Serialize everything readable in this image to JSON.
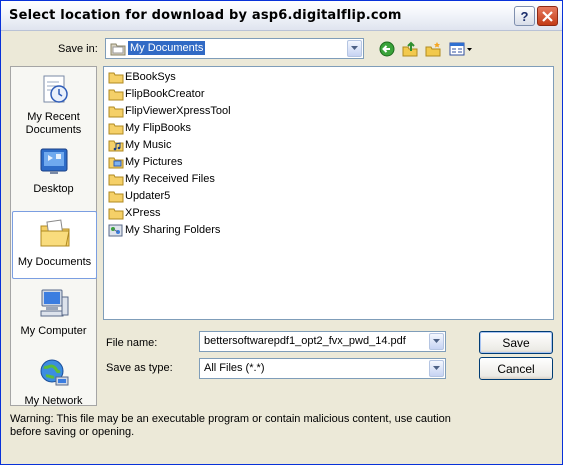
{
  "window": {
    "title": "Select location for download by asp6.digitalflip.com"
  },
  "toolbar": {
    "save_in_label": "Save in:",
    "save_in_value": "My Documents"
  },
  "places": [
    {
      "label_line1": "My Recent",
      "label_line2": "Documents",
      "icon": "recent-documents-icon"
    },
    {
      "label_line1": "Desktop",
      "label_line2": "",
      "icon": "desktop-icon"
    },
    {
      "label_line1": "My Documents",
      "label_line2": "",
      "icon": "my-documents-icon",
      "selected": true
    },
    {
      "label_line1": "My Computer",
      "label_line2": "",
      "icon": "my-computer-icon"
    },
    {
      "label_line1": "My Network",
      "label_line2": "",
      "icon": "my-network-icon"
    }
  ],
  "files": [
    {
      "name": "EBookSys",
      "icon": "folder-icon"
    },
    {
      "name": "FlipBookCreator",
      "icon": "folder-icon"
    },
    {
      "name": "FlipViewerXpressTool",
      "icon": "folder-icon"
    },
    {
      "name": "My FlipBooks",
      "icon": "folder-icon"
    },
    {
      "name": "My Music",
      "icon": "music-folder-icon"
    },
    {
      "name": "My Pictures",
      "icon": "pictures-folder-icon"
    },
    {
      "name": "My Received Files",
      "icon": "folder-icon"
    },
    {
      "name": "Updater5",
      "icon": "folder-icon"
    },
    {
      "name": "XPress",
      "icon": "folder-icon"
    },
    {
      "name": "My Sharing Folders",
      "icon": "sharing-folder-icon"
    }
  ],
  "form": {
    "file_name_label": "File name:",
    "file_name_value": "bettersoftwarepdf1_opt2_fvx_pwd_14.pdf",
    "save_as_type_label": "Save as type:",
    "save_as_type_value": "All Files (*.*)"
  },
  "buttons": {
    "save": "Save",
    "cancel": "Cancel"
  },
  "warning": "Warning: This file may be an executable program or contain malicious content, use caution before saving or opening."
}
